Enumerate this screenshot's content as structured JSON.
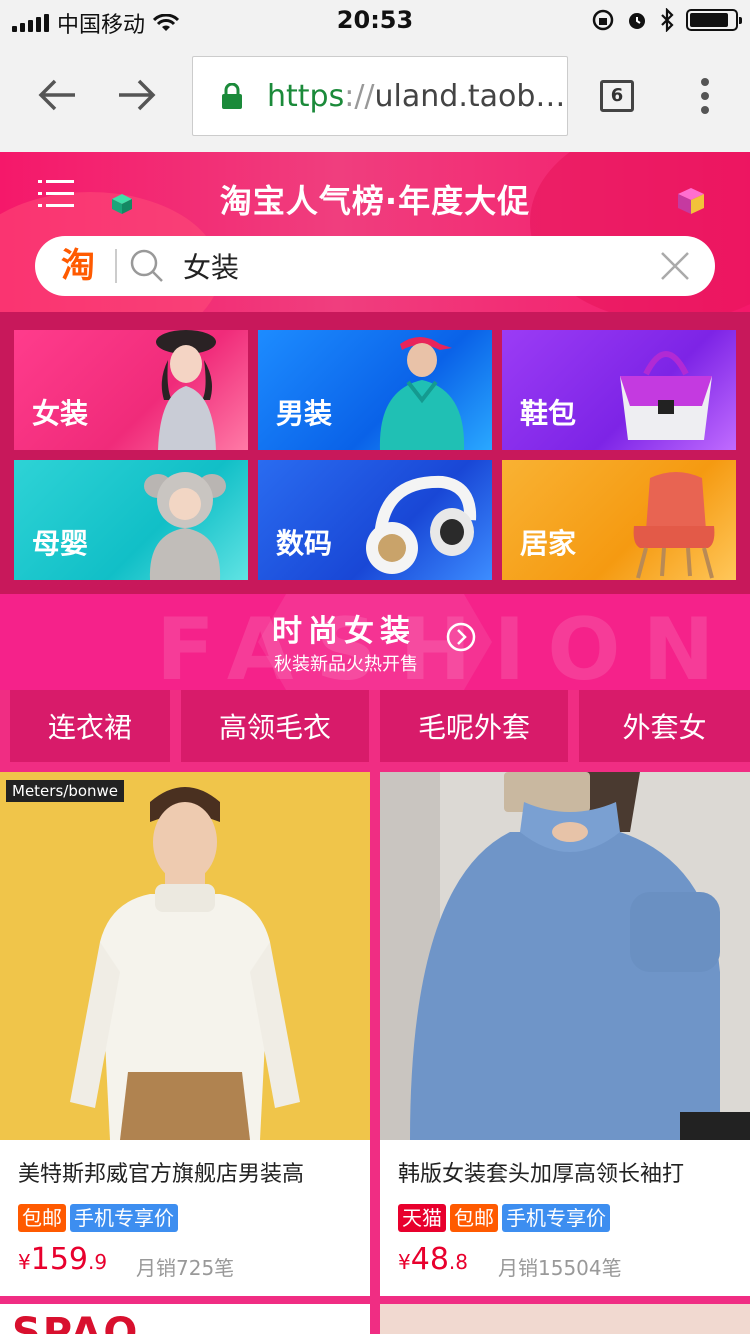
{
  "status_bar": {
    "carrier": "中国移动",
    "time": "20:53"
  },
  "browser": {
    "url_scheme": "https",
    "url_sep": "://",
    "url_host": "uland.taoba…",
    "tab_count": "6"
  },
  "header": {
    "title": "淘宝人气榜·年度大促",
    "search": {
      "logo_text": "淘",
      "query": "女装"
    }
  },
  "categories": [
    {
      "label": "女装"
    },
    {
      "label": "男装"
    },
    {
      "label": "鞋包"
    },
    {
      "label": "母婴"
    },
    {
      "label": "数码"
    },
    {
      "label": "居家"
    }
  ],
  "fashion_banner": {
    "watermark": "FASHION",
    "title": "时尚女装",
    "subtitle": "秋装新品火热开售"
  },
  "tags": [
    "连衣裙",
    "高领毛衣",
    "毛呢外套",
    "外套女"
  ],
  "products": [
    {
      "brand_tag": "Meters/bonwe",
      "title": "美特斯邦威官方旗舰店男装高",
      "badges": [
        "包邮",
        "手机专享价"
      ],
      "price_currency": "¥",
      "price_int": "159",
      "price_dec": ".9",
      "sales": "月销725笔"
    },
    {
      "title": "韩版女装套头加厚高领长袖打",
      "badges": [
        "天猫",
        "包邮",
        "手机专享价"
      ],
      "price_currency": "¥",
      "price_int": "48",
      "price_dec": ".8",
      "sales": "月销15504笔"
    }
  ],
  "next_row": {
    "left_brand": "SPAO"
  },
  "colors": {
    "accent": "#f02d83",
    "price": "#e8002d",
    "url_green": "#1b8a3a"
  }
}
